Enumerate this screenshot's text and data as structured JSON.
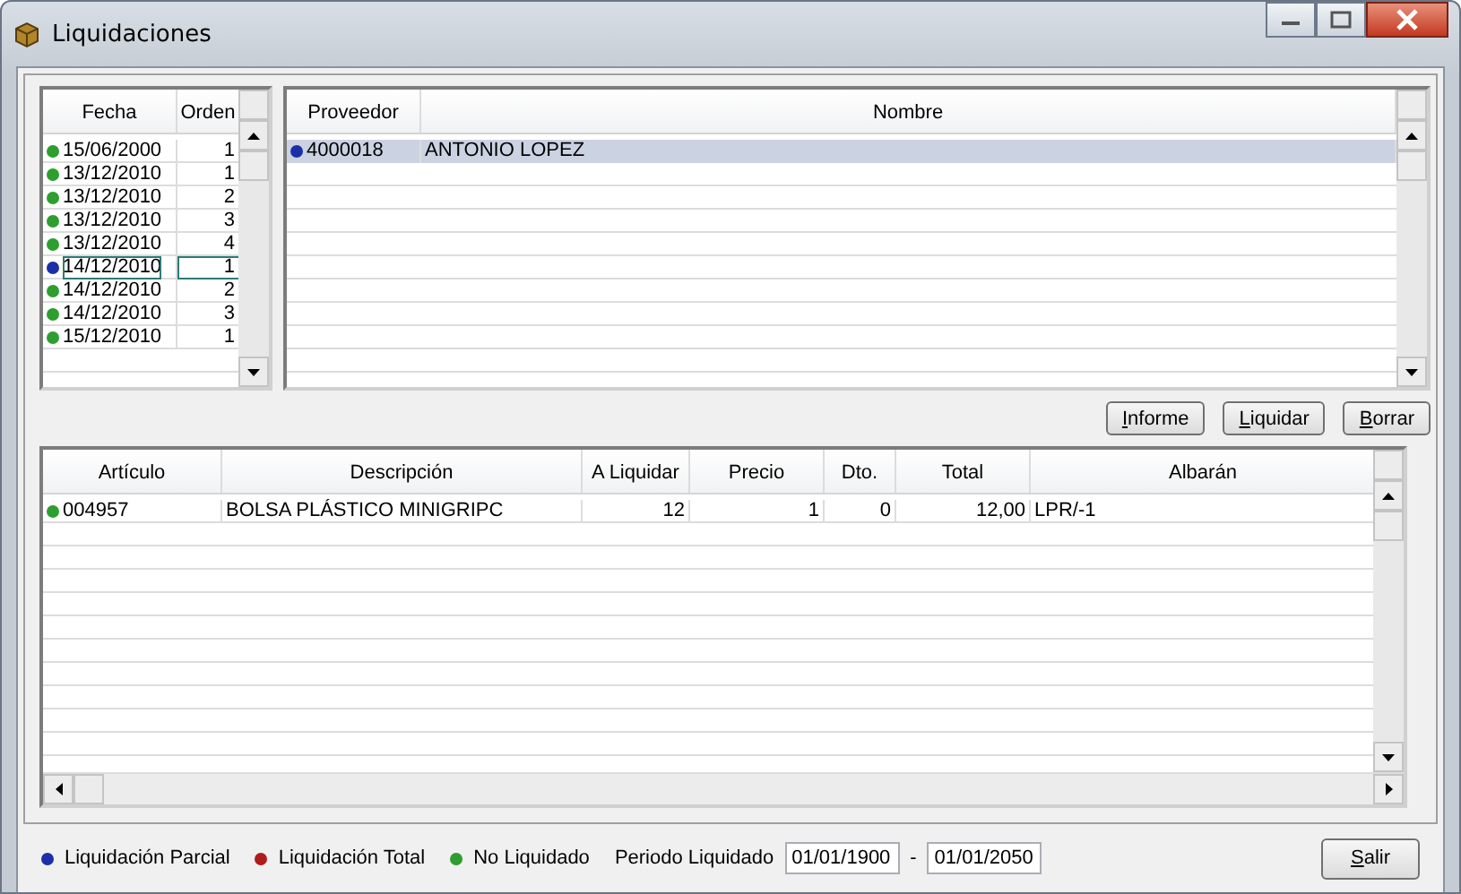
{
  "window": {
    "title": "Liquidaciones"
  },
  "dates_grid": {
    "columns": [
      "Fecha",
      "Orden"
    ],
    "rows": [
      {
        "fecha": "15/06/2000",
        "orden": "1",
        "color": "#2e9e2e",
        "selected": false
      },
      {
        "fecha": "13/12/2010",
        "orden": "1",
        "color": "#2e9e2e",
        "selected": false
      },
      {
        "fecha": "13/12/2010",
        "orden": "2",
        "color": "#2e9e2e",
        "selected": false
      },
      {
        "fecha": "13/12/2010",
        "orden": "3",
        "color": "#2e9e2e",
        "selected": false
      },
      {
        "fecha": "13/12/2010",
        "orden": "4",
        "color": "#2e9e2e",
        "selected": false
      },
      {
        "fecha": "14/12/2010",
        "orden": "1",
        "color": "#1c2fa8",
        "selected": true
      },
      {
        "fecha": "14/12/2010",
        "orden": "2",
        "color": "#2e9e2e",
        "selected": false
      },
      {
        "fecha": "14/12/2010",
        "orden": "3",
        "color": "#2e9e2e",
        "selected": false
      },
      {
        "fecha": "15/12/2010",
        "orden": "1",
        "color": "#2e9e2e",
        "selected": false
      }
    ]
  },
  "provider_grid": {
    "columns": [
      "Proveedor",
      "Nombre"
    ],
    "rows": [
      {
        "proveedor": "4000018",
        "nombre": "ANTONIO LOPEZ",
        "color": "#1c2fa8",
        "selected": true
      }
    ]
  },
  "buttons": [
    "Informe",
    "Liquidar",
    "Borrar"
  ],
  "lines_grid": {
    "columns": [
      "Artículo",
      "Descripción",
      "A Liquidar",
      "Precio",
      "Dto.",
      "Total",
      "Albarán"
    ],
    "rows": [
      {
        "cells": [
          "004957",
          "BOLSA PLÁSTICO MINIGRIPC",
          "12",
          "1",
          "0",
          "12,00",
          "LPR/-1"
        ],
        "color": "#2e9e2e"
      }
    ]
  },
  "legend": [
    {
      "label": "Liquidación Parcial",
      "color": "#1c2fa8"
    },
    {
      "label": "Liquidación Total",
      "color": "#b01c1c"
    },
    {
      "label": "No Liquidado",
      "color": "#2e9e2e"
    }
  ],
  "period": {
    "label": "Periodo Liquidado",
    "from": "01/01/1900",
    "separator": "-",
    "to": "01/01/2050"
  },
  "exit_button": "Salir"
}
